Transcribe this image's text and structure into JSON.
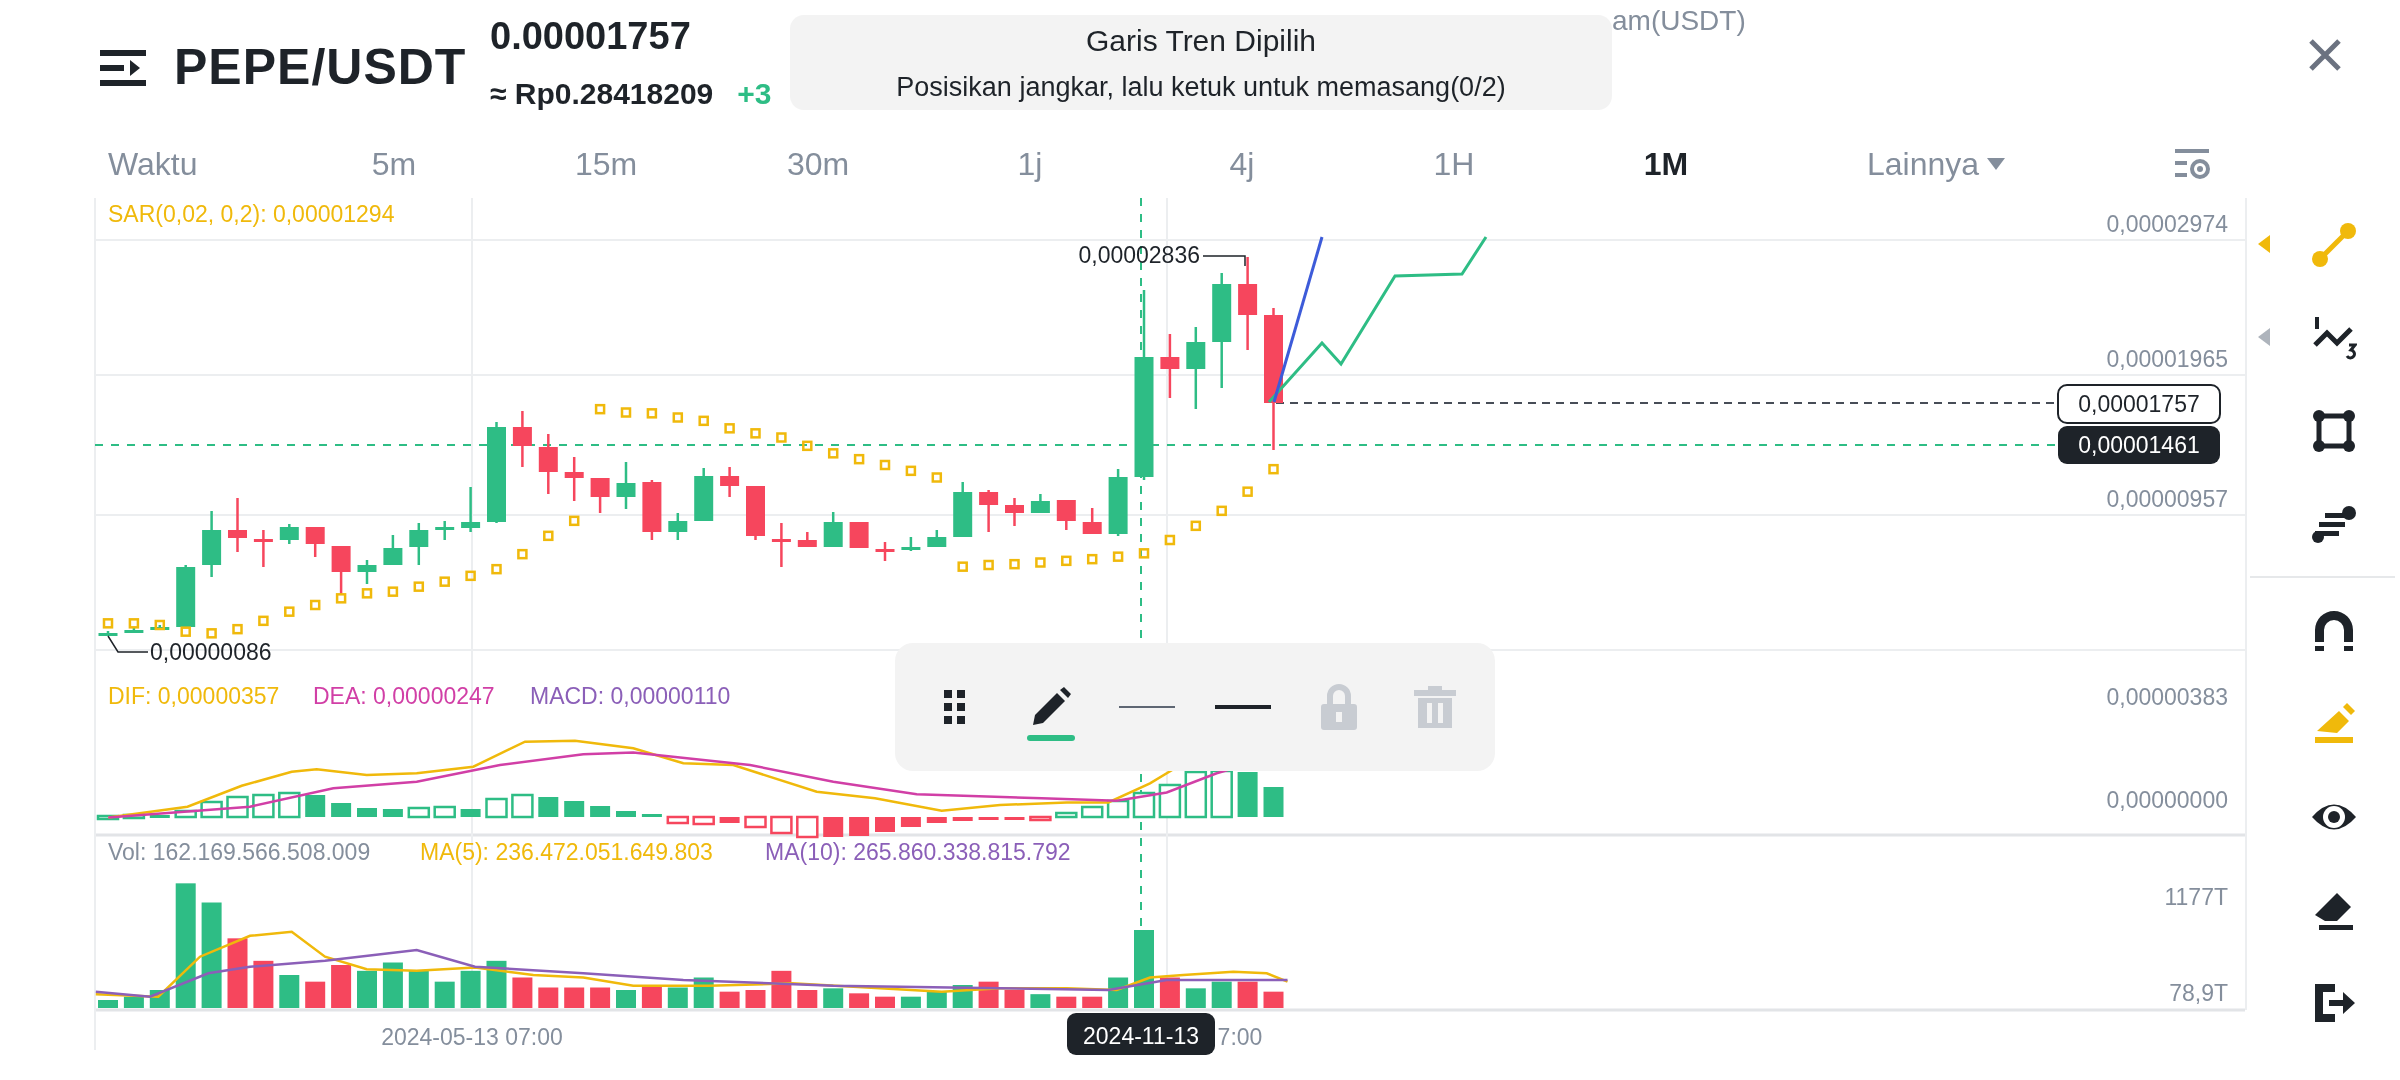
{
  "header": {
    "pair": "PEPE/USDT",
    "price": "0.00001757",
    "fiat_price": "≈ Rp0.28418209",
    "change": "+3",
    "stat_fragment": "am(USDT)"
  },
  "toast": {
    "title": "Garis Tren Dipilih",
    "message": "Posisikan jangkar, lalu ketuk untuk memasang(0/2)"
  },
  "tabs": [
    {
      "label": "Waktu",
      "kind": "label",
      "selected": false
    },
    {
      "label": "5m",
      "kind": "interval",
      "selected": false
    },
    {
      "label": "15m",
      "kind": "interval",
      "selected": false
    },
    {
      "label": "30m",
      "kind": "interval",
      "selected": false
    },
    {
      "label": "1j",
      "kind": "interval",
      "selected": false
    },
    {
      "label": "4j",
      "kind": "interval",
      "selected": false
    },
    {
      "label": "1H",
      "kind": "interval",
      "selected": false
    },
    {
      "label": "1M",
      "kind": "interval",
      "selected": true
    },
    {
      "label": "Lainnya",
      "kind": "dropdown",
      "selected": false
    }
  ],
  "chart": {
    "sar_label": "SAR(0,02, 0,2): 0,00001294",
    "price_axis": [
      "0,00002974",
      "0,00001965",
      "0,00000957"
    ],
    "last_price_tag": "0,00001757",
    "crosshair_price_tag": "0,00001461",
    "high_marker": "0,00002836",
    "low_marker": "0,00000086"
  },
  "macd": {
    "dif": "DIF: 0,00000357",
    "dea": "DEA: 0,00000247",
    "macd": "MACD: 0,00000110",
    "axis": [
      "0,00000383",
      "0,00000000"
    ]
  },
  "volume": {
    "vol": "Vol: 162.169.566.508.009",
    "ma5": "MA(5): 236.472.051.649.803",
    "ma10": "MA(10): 265.860.338.815.792",
    "axis": [
      "1177T",
      "78,9T"
    ]
  },
  "time_axis": {
    "labels": [
      "2024-05-13 07:00",
      "7:00"
    ],
    "crosshair_date": "2024-11-13"
  },
  "draw_toolbar": [
    {
      "kind": "handle",
      "selected": false,
      "disabled": false
    },
    {
      "kind": "pencil",
      "selected": true,
      "disabled": false
    },
    {
      "kind": "line-color",
      "selected": false,
      "disabled": false
    },
    {
      "kind": "line-width",
      "selected": false,
      "disabled": false
    },
    {
      "kind": "lock",
      "selected": false,
      "disabled": true
    },
    {
      "kind": "delete",
      "selected": false,
      "disabled": true
    }
  ],
  "side_tool_groups": [
    [
      {
        "kind": "trend-line",
        "selected": true,
        "has_menu": true
      },
      {
        "kind": "fibonacci",
        "selected": false,
        "has_menu": true
      },
      {
        "kind": "rectangle",
        "selected": false,
        "has_menu": false
      },
      {
        "kind": "lines",
        "selected": false,
        "has_menu": false
      }
    ],
    [
      {
        "kind": "magnet",
        "selected": false,
        "has_menu": false
      },
      {
        "kind": "pencil",
        "selected": true,
        "has_menu": false
      },
      {
        "kind": "eye",
        "selected": false,
        "has_menu": false
      },
      {
        "kind": "eraser",
        "selected": false,
        "has_menu": false
      },
      {
        "kind": "exit",
        "selected": false,
        "has_menu": false
      }
    ]
  ]
}
